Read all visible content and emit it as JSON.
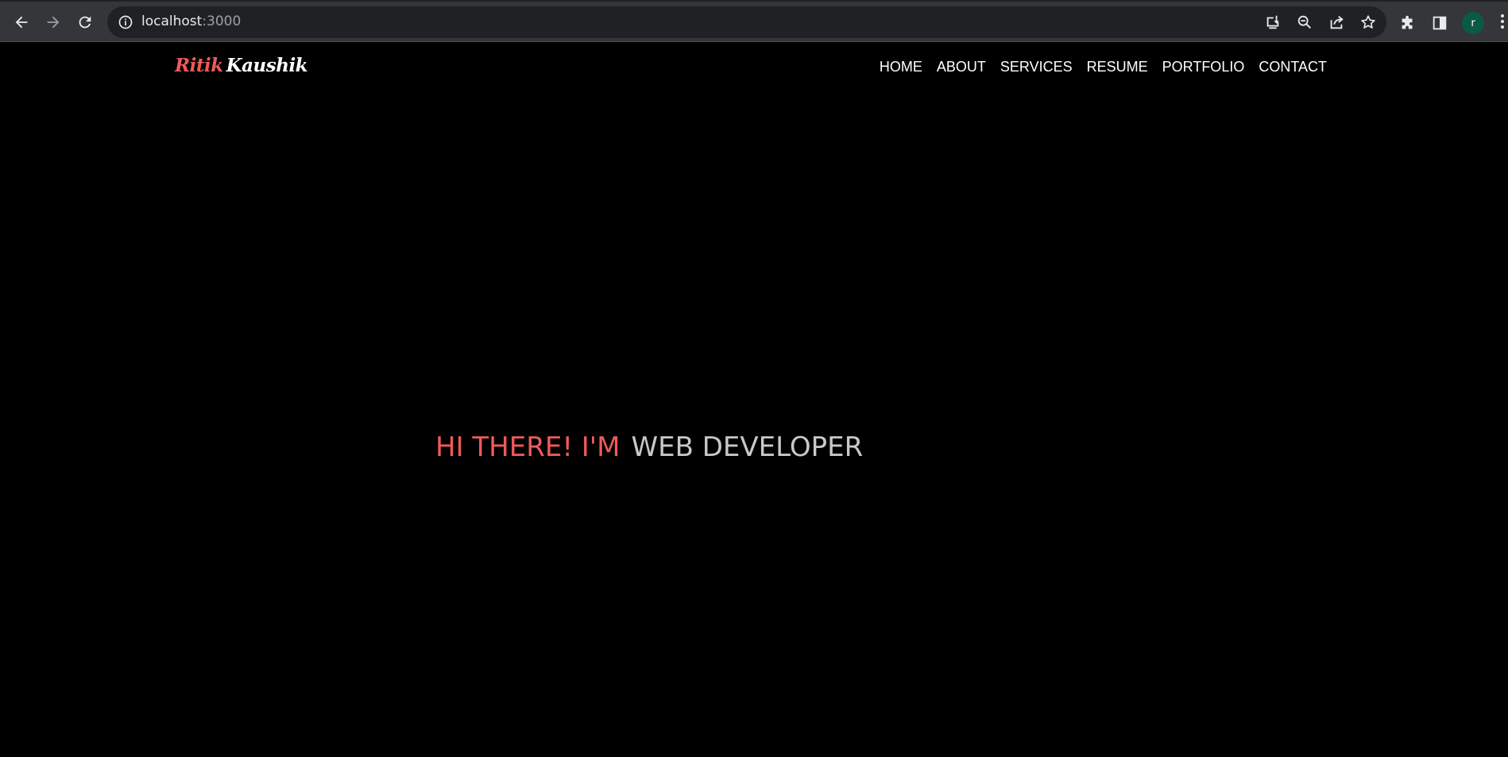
{
  "browser": {
    "url_host": "localhost",
    "url_port": ":3000",
    "profile_initial": "r",
    "icons": {
      "back": "back-arrow-icon",
      "forward": "forward-arrow-icon",
      "reload": "reload-icon",
      "info": "site-info-icon",
      "install": "install-app-icon",
      "zoom": "zoom-out-icon",
      "share": "share-icon",
      "bookmark": "star-bookmark-icon",
      "extensions": "puzzle-extensions-icon",
      "sidepanel": "side-panel-icon",
      "menu": "kebab-menu-icon"
    }
  },
  "site": {
    "logo": {
      "first": "Ritik",
      "last": "Kaushik"
    },
    "nav": [
      "HOME",
      "ABOUT",
      "SERVICES",
      "RESUME",
      "PORTFOLIO",
      "CONTACT"
    ],
    "hero": {
      "greeting": "HI THERE! I'M",
      "role": "WEB DEVELOPER"
    },
    "colors": {
      "accent": "#ef5a5a",
      "background": "#000000",
      "role_text": "#c8c8c8"
    }
  }
}
